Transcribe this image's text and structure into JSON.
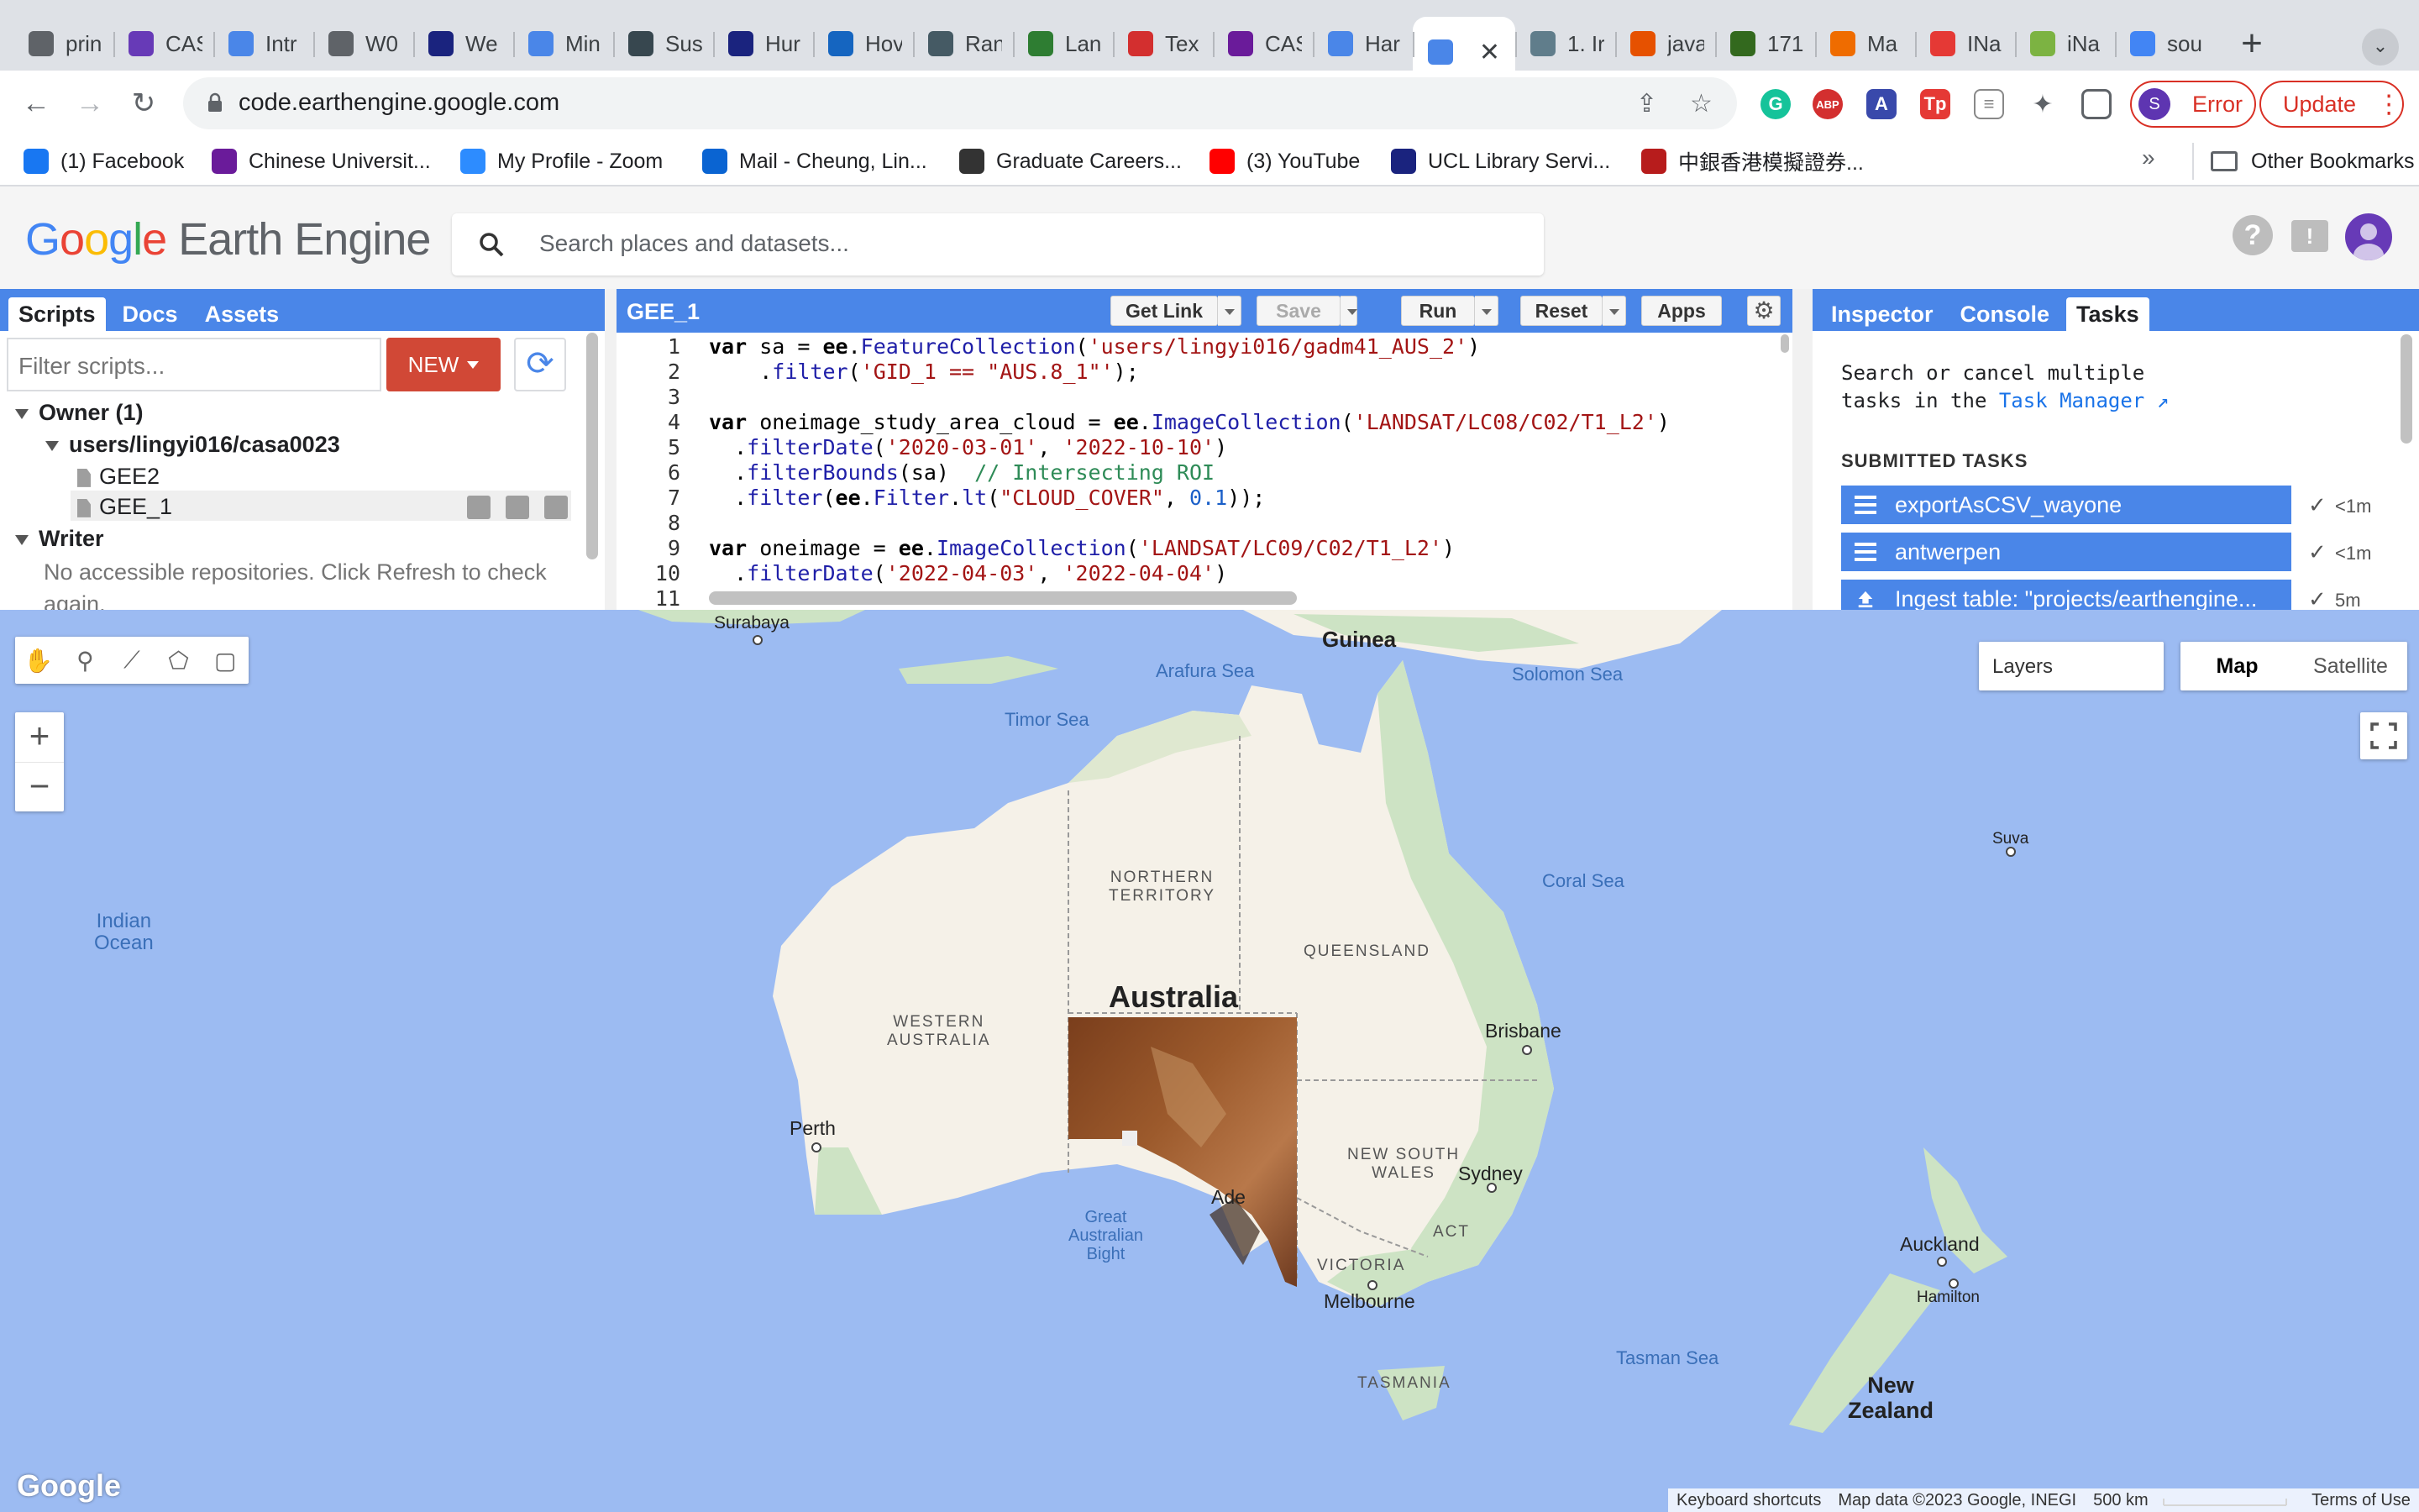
{
  "browser": {
    "tabs": [
      {
        "label": "prin",
        "icon": "globe-icon",
        "color": "#5f6368"
      },
      {
        "label": "CAS",
        "icon": "list-icon",
        "color": "#673ab7"
      },
      {
        "label": "Intr",
        "icon": "quill-icon",
        "color": "#4a86e8"
      },
      {
        "label": "W0",
        "icon": "globe-icon",
        "color": "#5f6368"
      },
      {
        "label": "We",
        "icon": "mm-icon",
        "color": "#1a237e"
      },
      {
        "label": "Min",
        "icon": "quill-icon",
        "color": "#4a86e8"
      },
      {
        "label": "Sus",
        "icon": "lock-icon",
        "color": "#37474f"
      },
      {
        "label": "Hur",
        "icon": "r-icon",
        "color": "#1a237e"
      },
      {
        "label": "Hov",
        "icon": "mountain-icon",
        "color": "#1565c0"
      },
      {
        "label": "Ran",
        "icon": "building-icon",
        "color": "#455a64"
      },
      {
        "label": "Lan",
        "icon": "envelope-icon",
        "color": "#2e7d32"
      },
      {
        "label": "Tex",
        "icon": "cookie-icon",
        "color": "#d32f2f"
      },
      {
        "label": "CAS",
        "icon": "puzzle-icon",
        "color": "#6a1b9a"
      },
      {
        "label": "Har",
        "icon": "eye-icon",
        "color": "#4a86e8"
      },
      {
        "label": "",
        "icon": "gear-icon",
        "color": "#4a86e8",
        "active": true
      },
      {
        "label": "1. Ir",
        "icon": "robot-icon",
        "color": "#607d8b"
      },
      {
        "label": "java",
        "icon": "java-icon",
        "color": "#e65100"
      },
      {
        "label": "171",
        "icon": "smile-icon",
        "color": "#33691e"
      },
      {
        "label": "Ma",
        "icon": "e-icon",
        "color": "#ef6c00"
      },
      {
        "label": "INa",
        "icon": "power-icon",
        "color": "#e53935"
      },
      {
        "label": "iNa",
        "icon": "leaf-icon",
        "color": "#7cb342"
      },
      {
        "label": "sou",
        "icon": "google-icon",
        "color": "#4285f4"
      }
    ],
    "close_glyph": "✕",
    "new_tab": "+",
    "url": "code.earthengine.google.com",
    "profile_initial": "S",
    "error_label": "Error",
    "update_label": "Update",
    "bookmarks": [
      {
        "label": "(1) Facebook",
        "icon": "facebook-icon",
        "color": "#1877f2"
      },
      {
        "label": "Chinese Universit...",
        "icon": "cuhk-icon",
        "color": "#6a1b9a"
      },
      {
        "label": "My Profile - Zoom",
        "icon": "zoom-icon",
        "color": "#2d8cff"
      },
      {
        "label": "Mail - Cheung, Lin...",
        "icon": "outlook-icon",
        "color": "#0a64d2"
      },
      {
        "label": "Graduate Careers...",
        "icon": "grad-icon",
        "color": "#333333"
      },
      {
        "label": "(3) YouTube",
        "icon": "youtube-icon",
        "color": "#ff0000"
      },
      {
        "label": "UCL Library Servi...",
        "icon": "ucl-icon",
        "color": "#1a237e"
      },
      {
        "label": "中銀香港模擬證券...",
        "icon": "boc-icon",
        "color": "#b71c1c"
      }
    ],
    "bookmarks_more": "»",
    "other_bookmarks": "Other Bookmarks"
  },
  "gee": {
    "logo_google": [
      "G",
      "o",
      "o",
      "g",
      "l",
      "e"
    ],
    "logo_product": "Earth Engine",
    "search_placeholder": "Search places and datasets...",
    "left_tabs": [
      "Scripts",
      "Docs",
      "Assets"
    ],
    "filter_placeholder": "Filter scripts...",
    "new_label": "NEW",
    "tree": {
      "owner": "Owner (1)",
      "repo": "users/lingyi016/casa0023",
      "files": [
        "GEE2",
        "GEE_1"
      ],
      "writer": "Writer",
      "writer_msg": "No accessible repositories. Click Refresh to check again."
    },
    "editor": {
      "title": "GEE_1",
      "buttons": {
        "get_link": "Get Link",
        "save": "Save",
        "run": "Run",
        "reset": "Reset",
        "apps": "Apps"
      },
      "line_numbers": [
        "1",
        "2",
        "3",
        "4",
        "5",
        "6",
        "7",
        "8",
        "9",
        "10",
        "11"
      ]
    },
    "right_tabs": [
      "Inspector",
      "Console",
      "Tasks"
    ],
    "tasks": {
      "desc_line1": "Search or cancel multiple",
      "desc_line2": "tasks in the ",
      "task_manager": "Task Manager",
      "submitted_header": "SUBMITTED TASKS",
      "items": [
        {
          "name": "exportAsCSV_wayone",
          "time": "<1m",
          "icon": "table-icon"
        },
        {
          "name": "antwerpen",
          "time": "<1m",
          "icon": "table-icon"
        },
        {
          "name": "Ingest table: \"projects/earthengine...",
          "time": "5m",
          "icon": "upload-icon"
        }
      ]
    }
  },
  "map": {
    "layers_label": "Layers",
    "map_label": "Map",
    "satellite_label": "Satellite",
    "zoom_in": "+",
    "zoom_out": "−",
    "labels": {
      "australia": "Australia",
      "western_australia": "WESTERN\nAUSTRALIA",
      "northern_territory": "NORTHERN\nTERRITORY",
      "queensland": "QUEENSLAND",
      "new_south_wales": "NEW SOUTH\nWALES",
      "victoria": "VICTORIA",
      "act": "ACT",
      "tasmania": "TASMANIA",
      "new_zealand": "New\nZealand",
      "guinea": "Guinea",
      "indian_ocean": "Indian\nOcean",
      "timor_sea": "Timor Sea",
      "arafura_sea": "Arafura Sea",
      "solomon_sea": "Solomon Sea",
      "coral_sea": "Coral Sea",
      "tasman_sea": "Tasman Sea",
      "great_australian_bight": "Great\nAustralian\nBight",
      "perth": "Perth",
      "brisbane": "Brisbane",
      "sydney": "Sydney",
      "melbourne": "Melbourne",
      "adelaide_partial": "Ade",
      "auckland": "Auckland",
      "hamilton": "Hamilton",
      "suva": "Suva",
      "surabaya": "Surabaya"
    },
    "google_watermark": "Google",
    "attribution": {
      "shortcuts": "Keyboard shortcuts",
      "data": "Map data ©2023 Google, INEGI",
      "scale": "500 km",
      "terms": "Terms of Use"
    },
    "colors": {
      "ocean": "#9cbbf2",
      "land": "#f5f1e8",
      "vegetation": "#cde3c4",
      "accent": "#4a86e8"
    }
  }
}
